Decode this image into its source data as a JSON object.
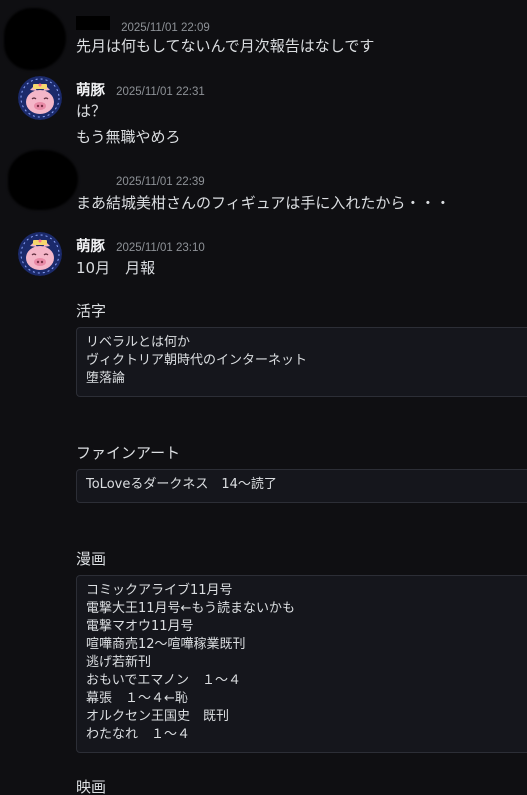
{
  "messages": [
    {
      "author": "",
      "timestamp": "2025/11/01 22:09",
      "lines": [
        "先月は何もしてないんで月次報告はなしです"
      ]
    },
    {
      "author": "萌豚",
      "timestamp": "2025/11/01 22:31",
      "lines": [
        "は？",
        "もう無職やめろ"
      ]
    },
    {
      "author": "",
      "timestamp": "2025/11/01 22:39",
      "lines": [
        "まあ結城美柑さんのフィギュアは手に入れたから・・・"
      ]
    },
    {
      "author": "萌豚",
      "timestamp": "2025/11/01 23:10",
      "lines": [
        "10月　月報"
      ],
      "sections": [
        {
          "label": "活字",
          "items": [
            "リベラルとは何か",
            "ヴィクトリア朝時代のインターネット",
            "堕落論"
          ]
        },
        {
          "label": "ファインアート",
          "items": [
            "ToLoveるダークネス　14〜読了"
          ]
        },
        {
          "label": "漫画",
          "items": [
            "コミックアライブ11月号",
            "電撃大王11月号←もう読まないかも",
            "電撃マオウ11月号",
            "喧嘩商売12〜喧嘩稼業既刊",
            "逃げ若新刊",
            "おもいでエマノン　１〜４",
            "幕張　１〜４←恥",
            "オルクセン王国史　既刊",
            "わたなれ　１〜４"
          ]
        },
        {
          "label": "映画",
          "items": []
        }
      ]
    }
  ],
  "colors": {
    "background": "#0f0f12",
    "text": "#dbdee1",
    "timestamp": "#8e9297",
    "codeblock_bg": "#15161c",
    "codeblock_border": "#2c2e36"
  }
}
